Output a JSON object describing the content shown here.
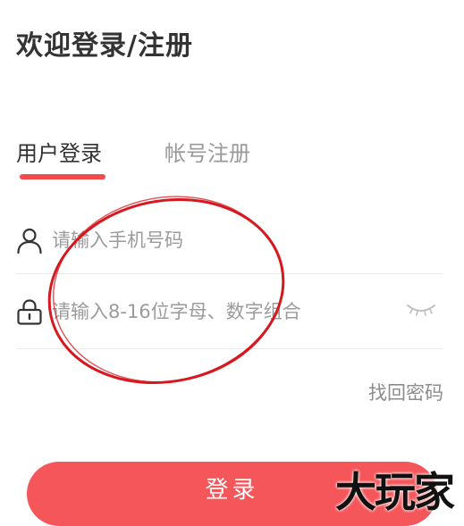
{
  "header": {
    "title": "欢迎登录/注册"
  },
  "tabs": [
    {
      "label": "用户登录",
      "active": true
    },
    {
      "label": "帐号注册",
      "active": false
    }
  ],
  "form": {
    "phone": {
      "icon": "user-icon",
      "value": "",
      "placeholder": "请输入手机号码"
    },
    "password": {
      "icon": "lock-icon",
      "value": "",
      "placeholder": "请输入8-16位字母、数字组合",
      "toggle_icon": "eye-closed-icon"
    },
    "forgot_label": "找回密码",
    "submit_label": "登录"
  },
  "overlay": {
    "watermark": "大玩家",
    "annotation": "red-circle-highlight"
  },
  "colors": {
    "accent": "#f24b4e",
    "button": "#f5565a",
    "title_text": "#333333",
    "inactive_tab": "#9a9a9a",
    "placeholder": "#9b9b9b",
    "annotation": "#d6181f"
  }
}
